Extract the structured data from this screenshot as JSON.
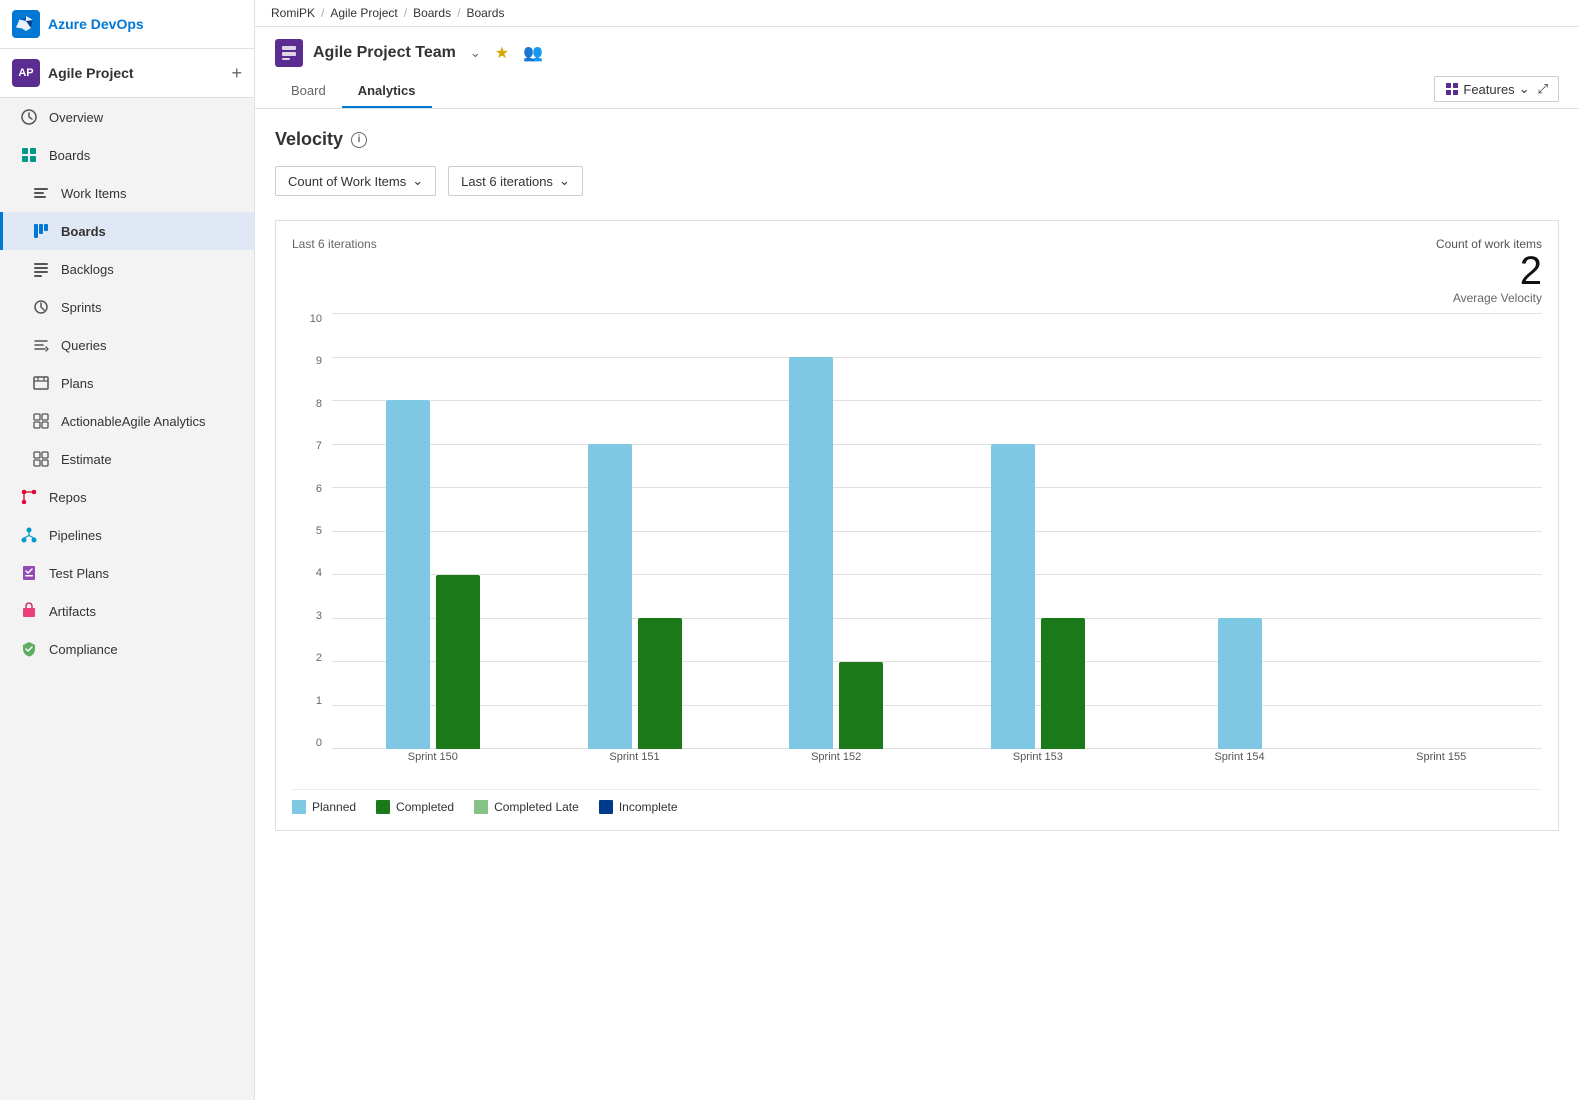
{
  "brand": {
    "logo_text": "Azure DevOps"
  },
  "project": {
    "avatar": "AP",
    "name": "Agile Project",
    "add_btn": "+"
  },
  "breadcrumb": {
    "items": [
      "RomiPK",
      "Agile Project",
      "Boards",
      "Boards"
    ]
  },
  "team": {
    "name": "Agile Project Team",
    "icon_color": "#5c2d91"
  },
  "tabs": [
    {
      "id": "board",
      "label": "Board"
    },
    {
      "id": "analytics",
      "label": "Analytics"
    }
  ],
  "features_btn": "Features",
  "page_title": "Velocity",
  "filters": {
    "metric": "Count of Work Items",
    "iteration": "Last 6 iterations"
  },
  "chart": {
    "label_left": "Last 6 iterations",
    "metric_name": "Count of work items",
    "metric_sub": "Average Velocity",
    "metric_value": "2",
    "y_labels": [
      "0",
      "1",
      "2",
      "3",
      "4",
      "5",
      "6",
      "7",
      "8",
      "9",
      "10"
    ],
    "sprints": [
      {
        "label": "Sprint 150",
        "planned": 8,
        "completed": 4
      },
      {
        "label": "Sprint 151",
        "planned": 7,
        "completed": 3
      },
      {
        "label": "Sprint 152",
        "planned": 9,
        "completed": 2
      },
      {
        "label": "Sprint 153",
        "planned": 7,
        "completed": 3
      },
      {
        "label": "Sprint 154",
        "planned": 3,
        "completed": 0
      },
      {
        "label": "Sprint 155",
        "planned": 0,
        "completed": 0
      }
    ],
    "max_value": 10
  },
  "legend": [
    {
      "label": "Planned",
      "color": "#7ec8e3"
    },
    {
      "label": "Completed",
      "color": "#1a7a1a"
    },
    {
      "label": "Completed Late",
      "color": "#85c285"
    },
    {
      "label": "Incomplete",
      "color": "#003a8c"
    }
  ],
  "nav": [
    {
      "id": "overview",
      "label": "Overview",
      "icon": "overview"
    },
    {
      "id": "boards-section",
      "label": "Boards",
      "icon": "boards-section"
    },
    {
      "id": "work-items",
      "label": "Work Items",
      "icon": "work-items"
    },
    {
      "id": "boards",
      "label": "Boards",
      "icon": "boards",
      "active": true
    },
    {
      "id": "backlogs",
      "label": "Backlogs",
      "icon": "backlogs"
    },
    {
      "id": "sprints",
      "label": "Sprints",
      "icon": "sprints"
    },
    {
      "id": "queries",
      "label": "Queries",
      "icon": "queries"
    },
    {
      "id": "plans",
      "label": "Plans",
      "icon": "plans"
    },
    {
      "id": "actionable",
      "label": "ActionableAgile Analytics",
      "icon": "actionable"
    },
    {
      "id": "estimate",
      "label": "Estimate",
      "icon": "estimate"
    },
    {
      "id": "repos",
      "label": "Repos",
      "icon": "repos"
    },
    {
      "id": "pipelines",
      "label": "Pipelines",
      "icon": "pipelines"
    },
    {
      "id": "test-plans",
      "label": "Test Plans",
      "icon": "test-plans"
    },
    {
      "id": "artifacts",
      "label": "Artifacts",
      "icon": "artifacts"
    },
    {
      "id": "compliance",
      "label": "Compliance",
      "icon": "compliance"
    }
  ]
}
